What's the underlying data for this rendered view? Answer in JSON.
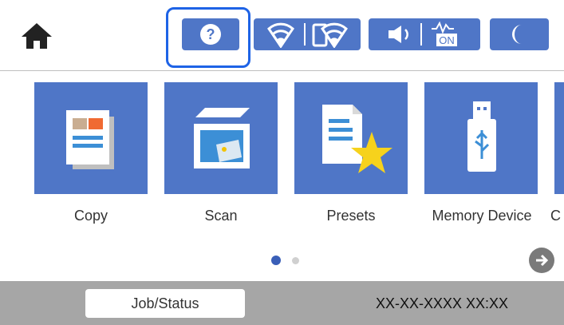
{
  "header": {
    "icons": {
      "home": "home-icon",
      "help": "help-icon",
      "network": [
        "wifi-icon",
        "wifi-direct-icon"
      ],
      "sound": [
        "speaker-icon",
        "power-on-icon"
      ],
      "sleep": "moon-icon"
    },
    "help_symbol": "?",
    "power_label": "ON"
  },
  "tiles": [
    {
      "label": "Copy",
      "icon": "copy-icon"
    },
    {
      "label": "Scan",
      "icon": "scan-icon"
    },
    {
      "label": "Presets",
      "icon": "presets-icon"
    },
    {
      "label": "Memory Device",
      "icon": "memory-device-icon"
    },
    {
      "label": "C",
      "icon": ""
    }
  ],
  "pagination": {
    "current": 1,
    "total": 2
  },
  "footer": {
    "job_status_label": "Job/Status",
    "datetime": "XX-XX-XXXX XX:XX"
  },
  "colors": {
    "accent": "#4f76c7",
    "highlight": "#1e63e6",
    "footer": "#a6a6a6"
  }
}
